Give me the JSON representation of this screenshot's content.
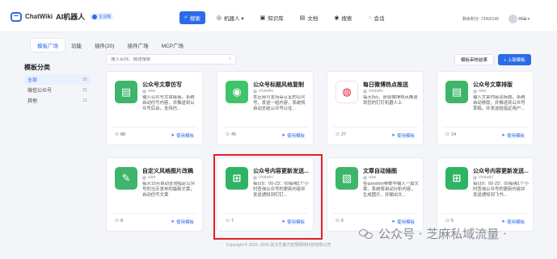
{
  "header": {
    "logo_name": "ChatWiki",
    "logo_ai": "AI机器人",
    "badge": "企业版",
    "nav": [
      {
        "icon": "⌕",
        "label": "搜索",
        "active": true
      },
      {
        "icon": "◎",
        "label": "机器人 ▾"
      },
      {
        "icon": "▣",
        "label": "知识库"
      },
      {
        "icon": "▤",
        "label": "文档"
      },
      {
        "icon": "◉",
        "label": "搜索"
      },
      {
        "icon": "◌",
        "label": "会话"
      }
    ],
    "credits": "剩余积分: 73492145",
    "user": "mia"
  },
  "tabs": [
    "模板广场",
    "功能",
    "插件(20)",
    "插件广场",
    "MCP广场"
  ],
  "sidebar": {
    "title": "模板分类",
    "items": [
      {
        "label": "全部",
        "count": "32"
      },
      {
        "label": "微信公众号",
        "count": "21"
      },
      {
        "label": "其他",
        "count": "11"
      }
    ]
  },
  "search": {
    "placeholder": "搜入名称、描述搜索"
  },
  "buttons": {
    "manage": "模板审核结果",
    "upload": "+ 上架模板"
  },
  "cards": [
    {
      "title": "公众号文章仿写",
      "author": "alan",
      "desc": "输入公众号文章链接，系统自动仿写内容，并推送到公众号后台。支持仿...",
      "count": "88",
      "use": "使用模板",
      "color": "#3fb46b",
      "icon": "▤"
    },
    {
      "title": "公众号标题风格复制",
      "author": "chatwiki",
      "desc": "本应用可支持采认证的公众号，发送一组内容，系统将自动总结公众号以往...",
      "count": "45",
      "use": "使用模板",
      "color": "#3fc46b",
      "icon": "◉"
    },
    {
      "title": "每日微博热点推送",
      "author": "chatwiki",
      "desc": "每天9点，获取微博热点推送到您的钉钉机器人上",
      "count": "27",
      "use": "使用模板",
      "color": "#ffffff",
      "icon": "◍"
    },
    {
      "title": "公众号文章排版",
      "author": "alan",
      "desc": "输入文章内容及标题，系统自动排版，并推送到公众号草稿，并发送给指定用户...",
      "count": "14",
      "use": "使用模板",
      "color": "#3fb46b",
      "icon": "▤"
    },
    {
      "title": "自定义风格图片改稿",
      "author": "alan",
      "desc": "每天15点自动查询指定公众号的当天发布的最新文章，自动仿写文章",
      "count": "8",
      "use": "使用模板",
      "color": "#3fb46b",
      "icon": "✎"
    },
    {
      "title": "公众号内容更新发送...",
      "author": "chatwiki",
      "desc": "每日9：00-23：00每隔1个小时查询公众号的更新内容并发送通知到钉钉...",
      "count": "7",
      "use": "使用模板",
      "color": "#2fb463",
      "icon": "⊞"
    },
    {
      "title": "文章自动插图",
      "author": "alan",
      "desc": "在question参数中输入一篇文章，系统将自动分析内容，生成图片，并输出文...",
      "count": "6",
      "use": "使用模板",
      "color": "#3fb46b",
      "icon": "▧"
    },
    {
      "title": "公众号内容更新发送...",
      "author": "chatwiki",
      "desc": "每日9：00-23：00每隔1个小时查询公众号的更新内容并发送通知到飞书...",
      "count": "5",
      "use": "使用模板",
      "color": "#2fb463",
      "icon": "⊞"
    }
  ],
  "footer": "Copyright © 2016- 2025 武汉艺睿方智慧网络科技有限公司",
  "watermark": "公众号 · 芝麻私域流量 ·"
}
